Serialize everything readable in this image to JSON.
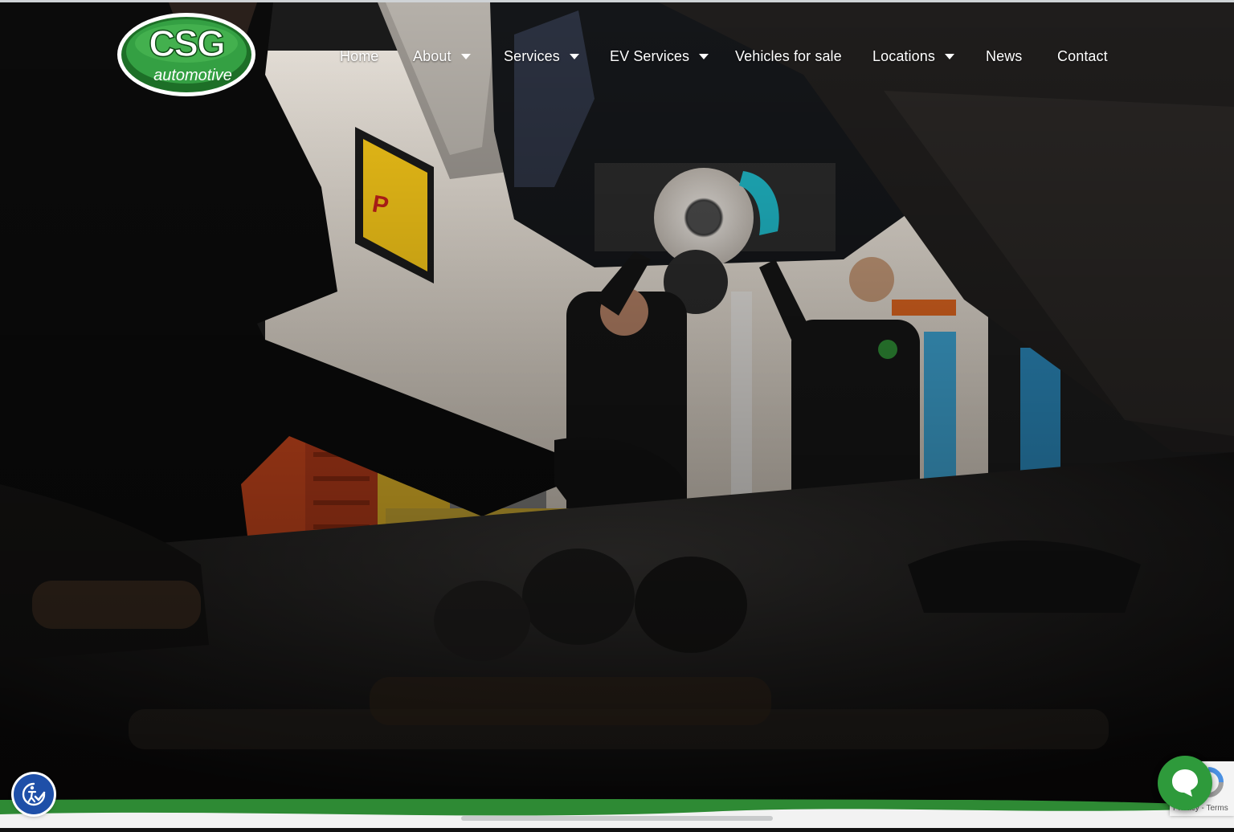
{
  "brand": {
    "logo_main": "CSG",
    "logo_sub": "automotive",
    "logo_green": "#2e8a34",
    "logo_green_dark": "#145c1d"
  },
  "nav": {
    "items": [
      {
        "label": "Home",
        "has_dropdown": false
      },
      {
        "label": "About",
        "has_dropdown": true
      },
      {
        "label": "Services",
        "has_dropdown": true
      },
      {
        "label": "EV Services",
        "has_dropdown": true
      },
      {
        "label": "Vehicles for sale",
        "has_dropdown": false
      },
      {
        "label": "Locations",
        "has_dropdown": true
      },
      {
        "label": "News",
        "has_dropdown": false
      },
      {
        "label": "Contact",
        "has_dropdown": false
      }
    ],
    "text_color": "#ffffff"
  },
  "hero": {
    "background": "workshop-video-still",
    "description_icon": "mechanics-working-on-car-video"
  },
  "widgets": {
    "accessibility_icon": "accessibility-checkmark-icon",
    "chat_icon": "chat-bubble-icon",
    "recaptcha_label": "Privacy - Terms",
    "recaptcha_icon": "recaptcha-icon"
  },
  "colors": {
    "band_green": "#2e8a34",
    "chat_green": "#2e9a3b",
    "accessibility_blue": "#1e4fa8"
  }
}
